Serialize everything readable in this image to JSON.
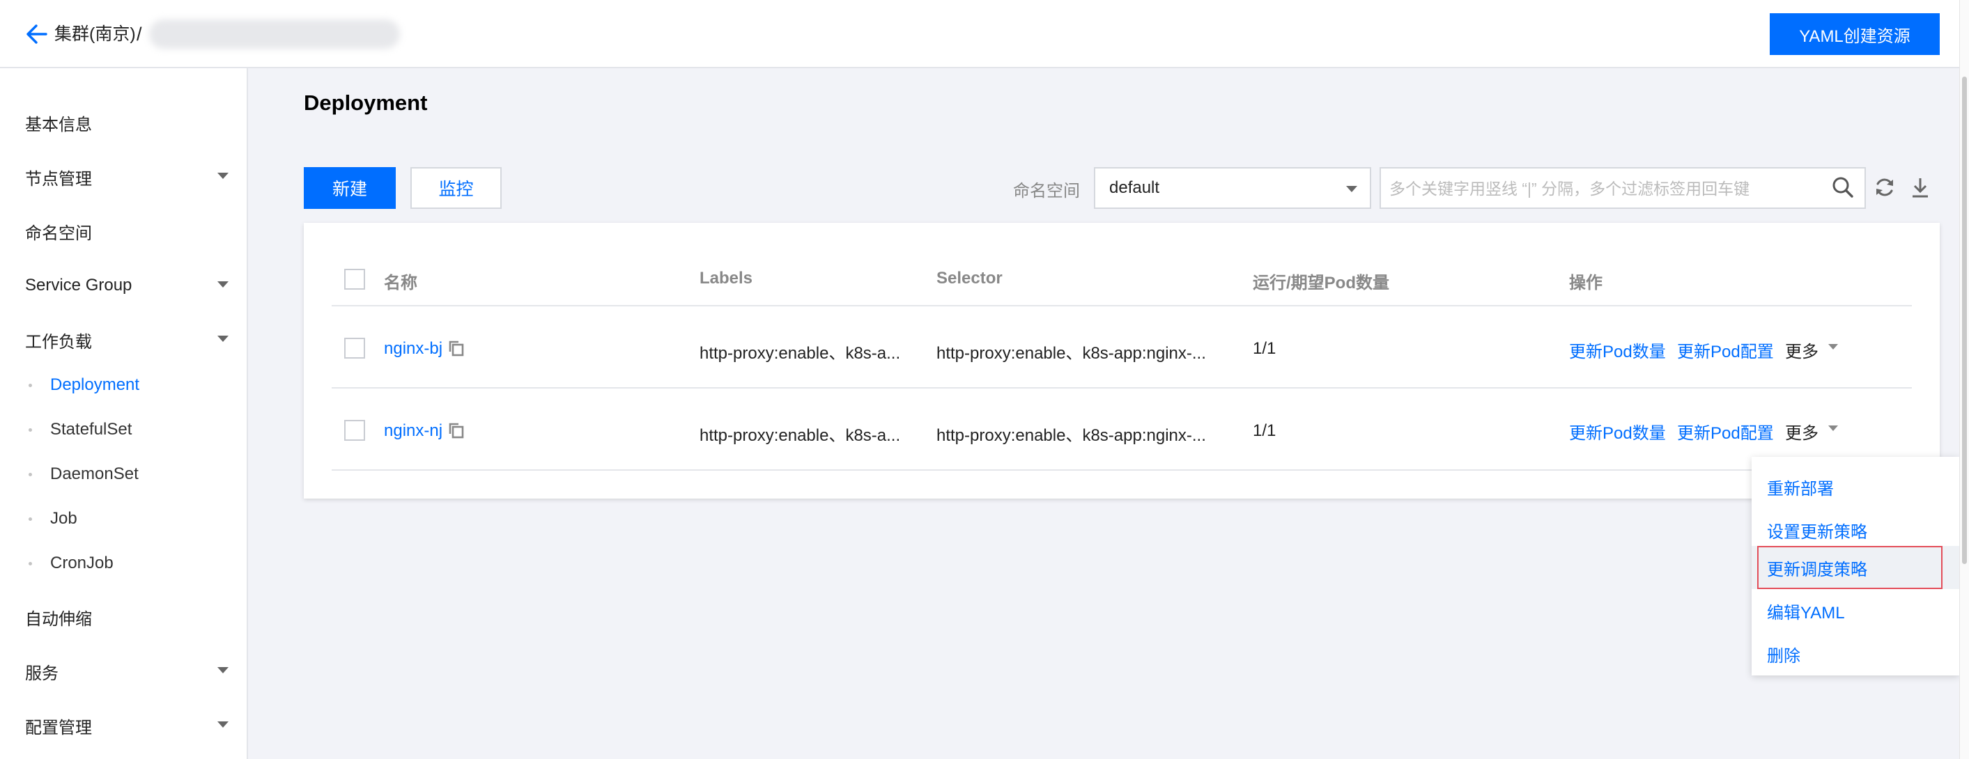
{
  "header": {
    "breadcrumb_cluster": "集群(南京)",
    "breadcrumb_separator": "/",
    "yaml_button": "YAML创建资源"
  },
  "sidebar": {
    "items": [
      {
        "label": "基本信息"
      },
      {
        "label": "节点管理",
        "expandable": true
      },
      {
        "label": "命名空间"
      },
      {
        "label": "Service Group",
        "expandable": true
      },
      {
        "label": "工作负载",
        "expandable": true,
        "expanded": true
      },
      {
        "label": "自动伸缩"
      },
      {
        "label": "服务",
        "expandable": true
      },
      {
        "label": "配置管理",
        "expandable": true
      }
    ],
    "workload_subitems": [
      {
        "label": "Deployment",
        "active": true
      },
      {
        "label": "StatefulSet"
      },
      {
        "label": "DaemonSet"
      },
      {
        "label": "Job"
      },
      {
        "label": "CronJob"
      }
    ]
  },
  "main": {
    "title": "Deployment",
    "new_button": "新建",
    "monitor_button": "监控",
    "namespace_label": "命名空间",
    "namespace_value": "default",
    "search_placeholder": "多个关键字用竖线 “|” 分隔，多个过滤标签用回车键"
  },
  "table": {
    "columns": [
      "名称",
      "Labels",
      "Selector",
      "运行/期望Pod数量",
      "操作"
    ],
    "rows": [
      {
        "name": "nginx-bj",
        "labels": "http-proxy:enable、k8s-a...",
        "selector": "http-proxy:enable、k8s-app:nginx-...",
        "pods": "1/1",
        "actions": [
          "更新Pod数量",
          "更新Pod配置",
          "更多"
        ]
      },
      {
        "name": "nginx-nj",
        "labels": "http-proxy:enable、k8s-a...",
        "selector": "http-proxy:enable、k8s-app:nginx-...",
        "pods": "1/1",
        "actions": [
          "更新Pod数量",
          "更新Pod配置",
          "更多"
        ]
      }
    ]
  },
  "dropdown_menu": {
    "items": [
      "重新部署",
      "设置更新策略",
      "更新调度策略",
      "编辑YAML",
      "删除"
    ],
    "highlighted": "更新调度策略"
  },
  "colors": {
    "accent": "#006eff",
    "page_background": "#f2f3f8",
    "highlight_border": "#e34d59"
  }
}
